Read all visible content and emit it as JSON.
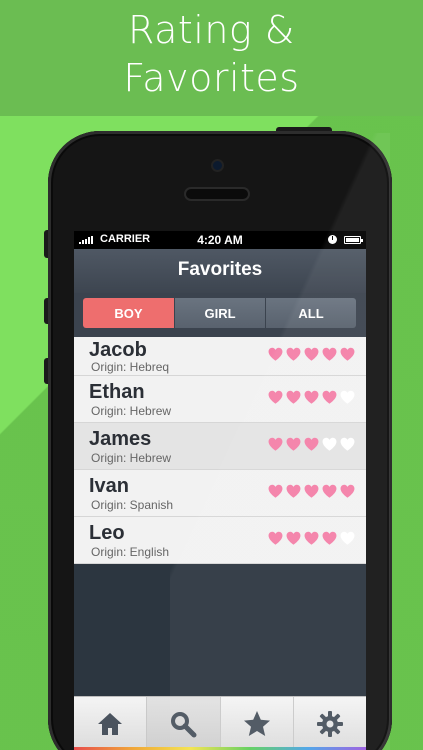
{
  "headline": {
    "line1": "Rating &",
    "line2": "Favorites"
  },
  "statusbar": {
    "carrier": "CARRIER",
    "time": "4:20 AM"
  },
  "navbar": {
    "title": "Favorites"
  },
  "segments": [
    {
      "label": "BOY",
      "active": true
    },
    {
      "label": "GIRL",
      "active": false
    },
    {
      "label": "ALL",
      "active": false
    }
  ],
  "names": [
    {
      "name": "Jacob",
      "origin": "Origin: Hebreq",
      "rating": 5
    },
    {
      "name": "Ethan",
      "origin": "Origin: Hebrew",
      "rating": 4
    },
    {
      "name": "James",
      "origin": "Origin: Hebrew",
      "rating": 3
    },
    {
      "name": "Ivan",
      "origin": "Origin: Spanish",
      "rating": 5
    },
    {
      "name": "Leo",
      "origin": "Origin: English",
      "rating": 4
    }
  ],
  "tabs": [
    {
      "icon": "home-icon",
      "selected": false
    },
    {
      "icon": "search-icon",
      "selected": true
    },
    {
      "icon": "star-icon",
      "selected": false
    },
    {
      "icon": "gear-icon",
      "selected": false
    }
  ],
  "colors": {
    "background": "#7fdc5f",
    "header_band": "#6bbd52",
    "segment_active": "#ee6e6e",
    "heart_filled": "#f47fa8",
    "heart_empty": "#ffffff",
    "icon": "#4a535e"
  }
}
